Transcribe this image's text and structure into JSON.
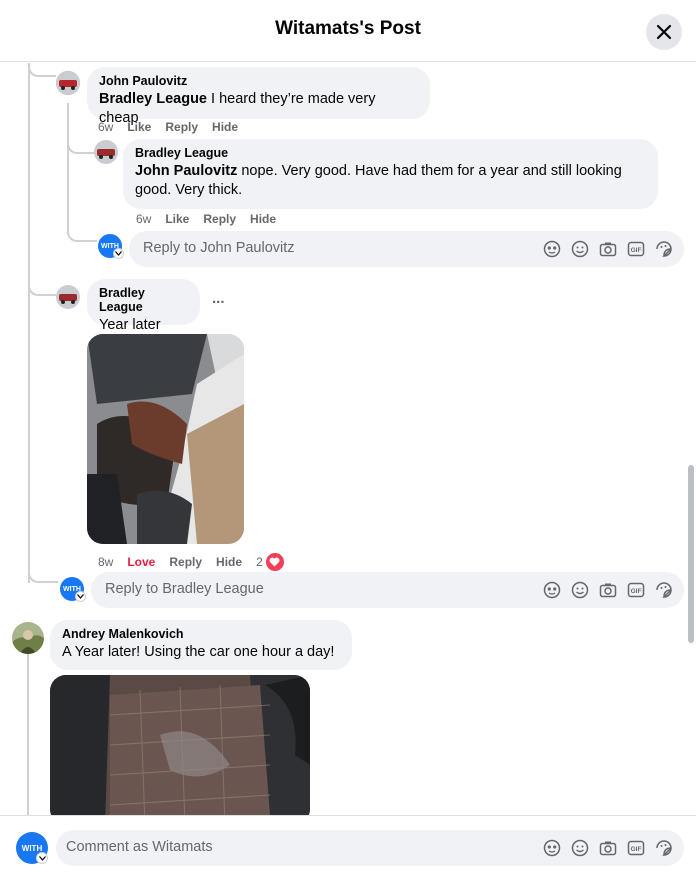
{
  "header": {
    "title": "Witamats's Post"
  },
  "comments": {
    "c1": {
      "author": "John Paulovitz",
      "mention": "Bradley League",
      "text": " I heard they’re made very cheap",
      "time": "6w",
      "like": "Like",
      "reply": "Reply",
      "hide": "Hide"
    },
    "c2": {
      "author": "Bradley League",
      "mention": "John Paulovitz",
      "text": " nope. Very good. Have had them for a year and still looking good. Very thick.",
      "time": "6w",
      "like": "Like",
      "reply": "Reply",
      "hide": "Hide"
    },
    "reply1": {
      "placeholder": "Reply to John Paulovitz"
    },
    "c3": {
      "author": "Bradley League",
      "text": "Year later",
      "more": "...",
      "time": "8w",
      "like": "Love",
      "reply": "Reply",
      "hide": "Hide",
      "reactions": "2"
    },
    "reply2": {
      "placeholder": "Reply to Bradley League"
    },
    "c4": {
      "author": "Andrey Malenkovich",
      "text": "A Year later! Using the car one hour a day!"
    }
  },
  "footer": {
    "placeholder": "Comment as Witamats"
  },
  "avatar_text": "WITH",
  "icons": [
    "avatar-icon",
    "emoji-icon",
    "camera-icon",
    "gif-icon",
    "sticker-icon"
  ],
  "colors": {
    "accent": "#1877f2",
    "love": "#e41e3f",
    "bubble": "#f0f2f5",
    "secondary_text": "#65676b"
  }
}
